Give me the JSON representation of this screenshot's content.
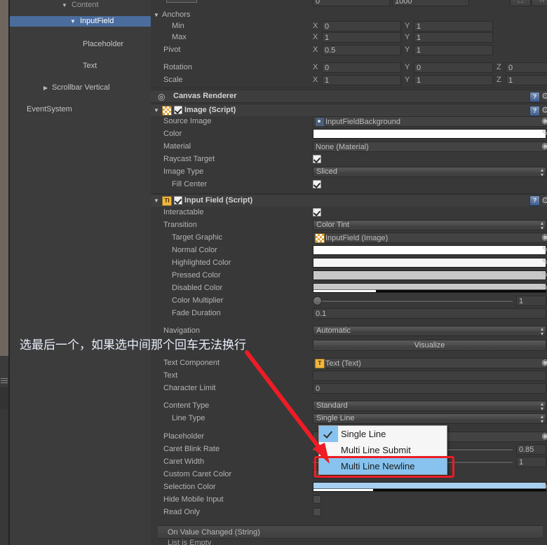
{
  "hierarchy": {
    "items": [
      {
        "label": "Content",
        "indent": 100,
        "tri": "down",
        "selected": false,
        "dim": true
      },
      {
        "label": "InputField",
        "indent": 117,
        "tri": "down",
        "selected": true,
        "dim": false
      },
      {
        "label": "Placeholder",
        "indent": 130,
        "tri": "none",
        "selected": false,
        "dim": false
      },
      {
        "label": "Text",
        "indent": 130,
        "tri": "none",
        "selected": false,
        "dim": false
      },
      {
        "label": "Scrollbar Vertical",
        "indent": 72,
        "tri": "right",
        "selected": false,
        "dim": false
      },
      {
        "label": "EventSystem",
        "indent": 38,
        "tri": "none",
        "selected": false,
        "dim": false
      }
    ]
  },
  "inspector": {
    "rect_transform": {
      "top_partial_value": "0",
      "top_partial_value2": "1000",
      "anchors_label": "Anchors",
      "rows": [
        {
          "label": "Min",
          "indent": 1,
          "x": "0",
          "y": "1"
        },
        {
          "label": "Max",
          "indent": 1,
          "x": "1",
          "y": "1"
        },
        {
          "label": "Pivot",
          "indent": 0,
          "x": "0.5",
          "y": "1"
        }
      ],
      "rotation": {
        "label": "Rotation",
        "x": "0",
        "y": "0",
        "z": "0"
      },
      "scale": {
        "label": "Scale",
        "x": "1",
        "y": "1",
        "z": "1"
      },
      "axis_x": "X",
      "axis_y": "Y",
      "axis_z": "Z"
    },
    "canvas_renderer": {
      "title": "Canvas Renderer"
    },
    "image_script": {
      "title": "Image (Script)",
      "enabled": true,
      "rows": {
        "source_image": {
          "label": "Source Image",
          "value": "InputFieldBackground"
        },
        "color": {
          "label": "Color",
          "value": "#FFFFFF"
        },
        "material": {
          "label": "Material",
          "value": "None (Material)"
        },
        "raycast_target": {
          "label": "Raycast Target",
          "checked": true
        },
        "image_type": {
          "label": "Image Type",
          "value": "Sliced"
        },
        "fill_center": {
          "label": "Fill Center",
          "checked": true
        }
      }
    },
    "input_field_script": {
      "title": "Input Field (Script)",
      "enabled": true,
      "interactable": {
        "label": "Interactable",
        "checked": true
      },
      "transition": {
        "label": "Transition",
        "value": "Color Tint"
      },
      "target_graphic": {
        "label": "Target Graphic",
        "value": "InputField (Image)"
      },
      "normal_color": {
        "label": "Normal Color",
        "value": "#FFFFFF"
      },
      "highlighted_color": {
        "label": "Highlighted Color",
        "value": "#F5F5F5"
      },
      "pressed_color": {
        "label": "Pressed Color",
        "value": "#C8C8C8"
      },
      "disabled_color": {
        "label": "Disabled Color",
        "value": "#C8C8C8"
      },
      "color_multiplier": {
        "label": "Color Multiplier",
        "value": "1"
      },
      "fade_duration": {
        "label": "Fade Duration",
        "value": "0.1"
      },
      "navigation": {
        "label": "Navigation",
        "value": "Automatic"
      },
      "visualize_button": {
        "label": "Visualize"
      },
      "text_component": {
        "label": "Text Component",
        "value": "Text (Text)"
      },
      "text": {
        "label": "Text",
        "value": ""
      },
      "character_limit": {
        "label": "Character Limit",
        "value": "0"
      },
      "content_type": {
        "label": "Content Type",
        "value": "Standard"
      },
      "line_type": {
        "label": "Line Type",
        "value": "Single Line"
      },
      "placeholder": {
        "label": "Placeholder",
        "value": ""
      },
      "caret_blink_rate": {
        "label": "Caret Blink Rate",
        "value": "0.85"
      },
      "caret_width": {
        "label": "Caret Width",
        "value": "1"
      },
      "custom_caret_color": {
        "label": "Custom Caret Color",
        "checked": false
      },
      "selection_color": {
        "label": "Selection Color",
        "value": "#A8CFF0"
      },
      "hide_mobile_input": {
        "label": "Hide Mobile Input",
        "checked": false
      },
      "read_only": {
        "label": "Read Only",
        "checked": false
      },
      "on_value_changed": {
        "label": "On Value Changed (String)",
        "empty_text": "List is Empty"
      }
    }
  },
  "line_type_dropdown": {
    "open": true,
    "options": [
      "Single Line",
      "Multi Line Submit",
      "Multi Line Newline"
    ],
    "selected_index": 0,
    "highlighted_index": 2
  },
  "annotation": {
    "note_text": "选最后一个，如果选中间那个回车无法换行",
    "note_color": "#e9eefb",
    "arrow_color": "#ee1c25",
    "highlight_color": "#ec1c24"
  },
  "icons": {
    "help": "?",
    "gear": "⚙",
    "target": "◉",
    "eye": "◎",
    "eyedropper": "eyedropper-icon"
  }
}
